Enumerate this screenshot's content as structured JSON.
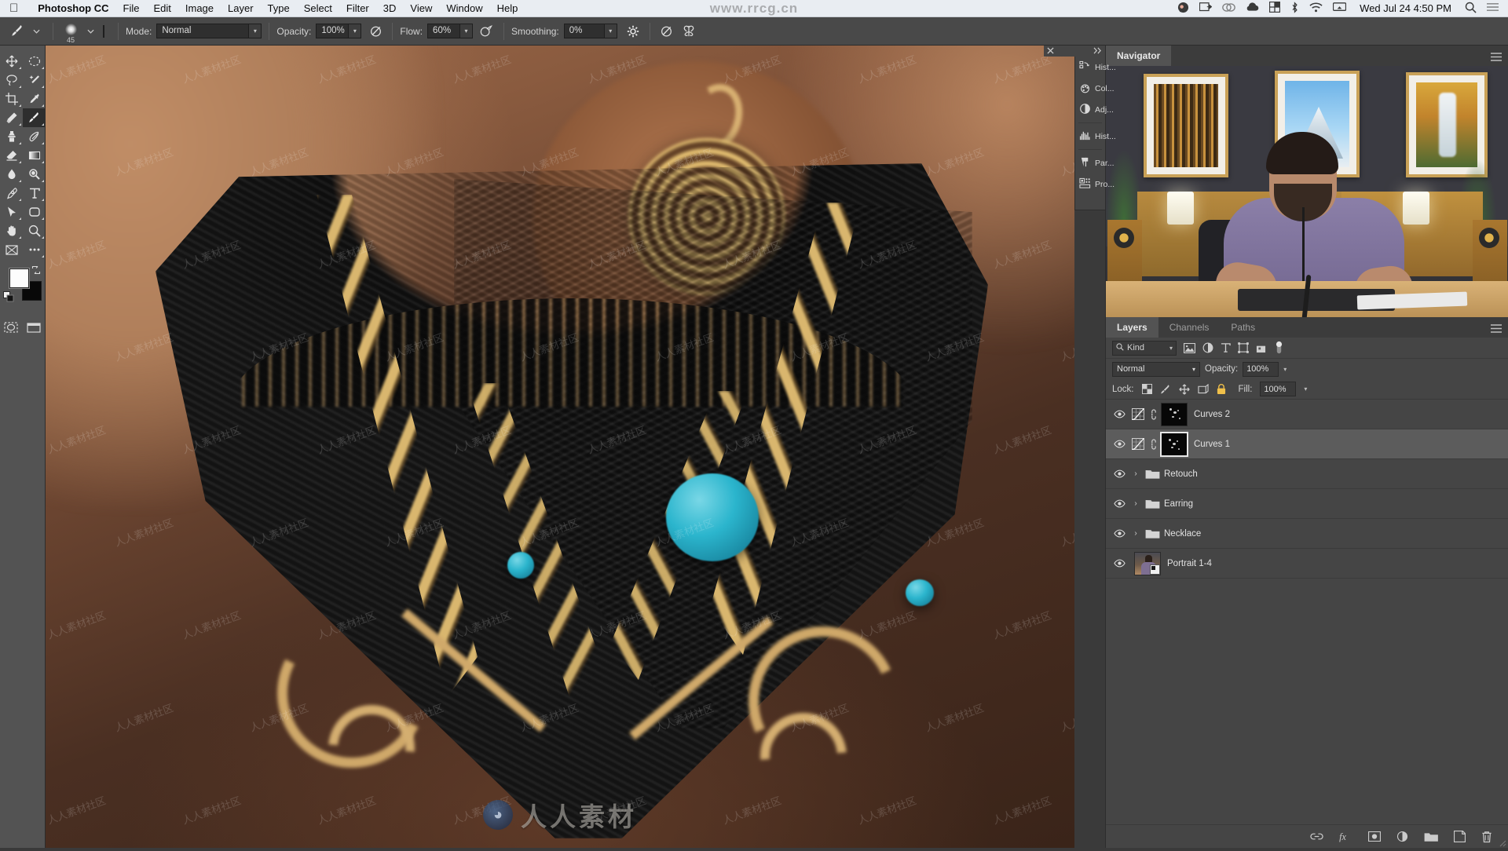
{
  "menubar": {
    "apple_icon": "apple-logo",
    "app_name": "Photoshop CC",
    "items": [
      "File",
      "Edit",
      "Image",
      "Layer",
      "Type",
      "Select",
      "Filter",
      "3D",
      "View",
      "Window",
      "Help"
    ],
    "status_icons": [
      "user-avatar-icon",
      "screen-share-icon",
      "creative-cloud-icon",
      "cloud-icon",
      "grid-icon",
      "bluetooth-icon",
      "wifi-icon",
      "airplay-icon"
    ],
    "clock": "Wed Jul 24  4:50 PM",
    "search_icon": "search-icon",
    "control-center_icon": "list-icon"
  },
  "options_bar": {
    "tool_icon": "brush-tool-icon",
    "brush_size": "45",
    "brush_preset_icon": "brush-preset-icon",
    "mode_label": "Mode:",
    "mode_value": "Normal",
    "opacity_label": "Opacity:",
    "opacity_value": "100%",
    "pressure_opacity_icon": "pressure-opacity-icon",
    "flow_label": "Flow:",
    "flow_value": "60%",
    "airbrush_icon": "airbrush-icon",
    "smoothing_label": "Smoothing:",
    "smoothing_value": "0%",
    "smoothing_options_icon": "gear-icon",
    "tablet_pressure_icon": "tablet-pressure-icon",
    "symmetry_icon": "symmetry-butterfly-icon"
  },
  "toolbar": {
    "tools": [
      {
        "name": "move-tool",
        "icon": "move-icon"
      },
      {
        "name": "elliptical-marquee-tool",
        "icon": "marquee-ellipse-icon"
      },
      {
        "name": "lasso-tool",
        "icon": "lasso-icon"
      },
      {
        "name": "quick-selection-tool",
        "icon": "magic-wand-icon"
      },
      {
        "name": "crop-tool",
        "icon": "crop-icon"
      },
      {
        "name": "eyedropper-tool",
        "icon": "eyedropper-icon"
      },
      {
        "name": "spot-healing-brush-tool",
        "icon": "healing-brush-icon"
      },
      {
        "name": "brush-tool",
        "icon": "paintbrush-icon",
        "active": true
      },
      {
        "name": "clone-stamp-tool",
        "icon": "clone-stamp-icon"
      },
      {
        "name": "history-brush-tool",
        "icon": "history-brush-icon"
      },
      {
        "name": "eraser-tool",
        "icon": "eraser-icon"
      },
      {
        "name": "gradient-tool",
        "icon": "gradient-icon"
      },
      {
        "name": "blur-tool",
        "icon": "blur-drop-icon"
      },
      {
        "name": "dodge-tool",
        "icon": "dodge-icon"
      },
      {
        "name": "pen-tool",
        "icon": "pen-icon"
      },
      {
        "name": "type-tool",
        "icon": "type-t-icon"
      },
      {
        "name": "path-selection-tool",
        "icon": "path-arrow-icon"
      },
      {
        "name": "rounded-rectangle-tool",
        "icon": "rounded-rect-icon"
      },
      {
        "name": "hand-tool",
        "icon": "hand-icon"
      },
      {
        "name": "zoom-tool",
        "icon": "magnifier-icon"
      },
      {
        "name": "edit-toolbar",
        "icon": "frame-icon"
      },
      {
        "name": "more-tools",
        "icon": "ellipsis-icon"
      }
    ],
    "foreground_color": "#fdfdfd",
    "background_color": "#080808",
    "swap_colors_icon": "swap-arrows-icon",
    "default_colors_icon": "default-colors-icon",
    "quick_mask_icon": "quick-mask-icon",
    "screen_mode_icon": "screen-mode-icon"
  },
  "canvas": {
    "document_description": "Close-up photo of a black macrame collar necklace with gold beads, a gold spiral pendant and turquoise stones on a display stand",
    "watermark_top": "www.rrcg.cn",
    "watermark_bottom": "人人素材",
    "watermark_tile": "人人素材社区"
  },
  "icon_dock": {
    "close_icon": "close-icon",
    "expand_icon": "double-chevron-right-icon",
    "items": [
      {
        "label": "Hist...",
        "icon": "history-panel-icon",
        "name": "history-dock-item"
      },
      {
        "label": "Col...",
        "icon": "color-wheel-icon",
        "name": "color-dock-item"
      },
      {
        "label": "Adj...",
        "icon": "adjustments-icon",
        "name": "adjustments-dock-item"
      },
      {
        "label": "Hist...",
        "icon": "histogram-icon",
        "name": "histogram-dock-item"
      },
      {
        "label": "Par...",
        "icon": "paragraph-icon",
        "name": "paragraph-dock-item"
      },
      {
        "label": "Pro...",
        "icon": "properties-icon",
        "name": "properties-dock-item"
      }
    ]
  },
  "navigator": {
    "tab_label": "Navigator",
    "menu_icon": "panel-menu-icon",
    "preview_description": "Video frame: instructor sitting at a desk with framed landscape photos on a dark wall, two lamps, plants and studio speakers"
  },
  "layers": {
    "tabs": [
      {
        "label": "Layers",
        "active": true
      },
      {
        "label": "Channels",
        "active": false
      },
      {
        "label": "Paths",
        "active": false
      }
    ],
    "menu_icon": "panel-menu-icon",
    "filter": {
      "search_icon": "search-icon",
      "kind_label": "Kind",
      "caret_icon": "chevron-down-icon",
      "type_filters": [
        "pixel-layer-filter-icon",
        "adjustment-layer-filter-icon",
        "type-layer-filter-icon",
        "shape-layer-filter-icon",
        "smart-object-filter-icon"
      ],
      "toggle_icon": "filter-toggle-icon"
    },
    "blend_mode_label": "",
    "blend_mode_value": "Normal",
    "opacity_label": "Opacity:",
    "opacity_value": "100%",
    "lock_label": "Lock:",
    "lock_icons": [
      "lock-transparent-pixels-icon",
      "lock-image-pixels-icon",
      "lock-position-icon",
      "lock-artboard-nesting-icon",
      "lock-all-icon"
    ],
    "fill_label": "Fill:",
    "fill_value": "100%",
    "rows": [
      {
        "name": "Curves 2",
        "type": "adjustment",
        "visible": true,
        "selected": false,
        "linked": true,
        "mask_selected": false
      },
      {
        "name": "Curves 1",
        "type": "adjustment",
        "visible": true,
        "selected": true,
        "linked": true,
        "mask_selected": true
      },
      {
        "name": "Retouch",
        "type": "group",
        "visible": true,
        "selected": false
      },
      {
        "name": "Earring",
        "type": "group",
        "visible": true,
        "selected": false
      },
      {
        "name": "Necklace",
        "type": "group",
        "visible": true,
        "selected": false
      },
      {
        "name": "Portrait 1-4",
        "type": "image",
        "visible": true,
        "selected": false
      }
    ],
    "footer_buttons": [
      {
        "name": "link-layers-button",
        "icon": "link-icon"
      },
      {
        "name": "layer-style-button",
        "icon": "fx-icon"
      },
      {
        "name": "add-layer-mask-button",
        "icon": "mask-icon"
      },
      {
        "name": "new-adjustment-layer-button",
        "icon": "half-circle-icon"
      },
      {
        "name": "new-group-button",
        "icon": "folder-icon"
      },
      {
        "name": "new-layer-button",
        "icon": "new-layer-icon"
      },
      {
        "name": "delete-layer-button",
        "icon": "trash-icon"
      }
    ]
  },
  "colors": {
    "menubar_bg": "#e9edf2",
    "options_bar_bg": "#494949",
    "toolbar_bg": "#535353",
    "panel_bg": "#454545",
    "selected_row_bg": "#5c5c5c",
    "canvas_bg": "#3f3f3f",
    "turquoise": "#2bb5cd",
    "gold": "#d8b071"
  }
}
